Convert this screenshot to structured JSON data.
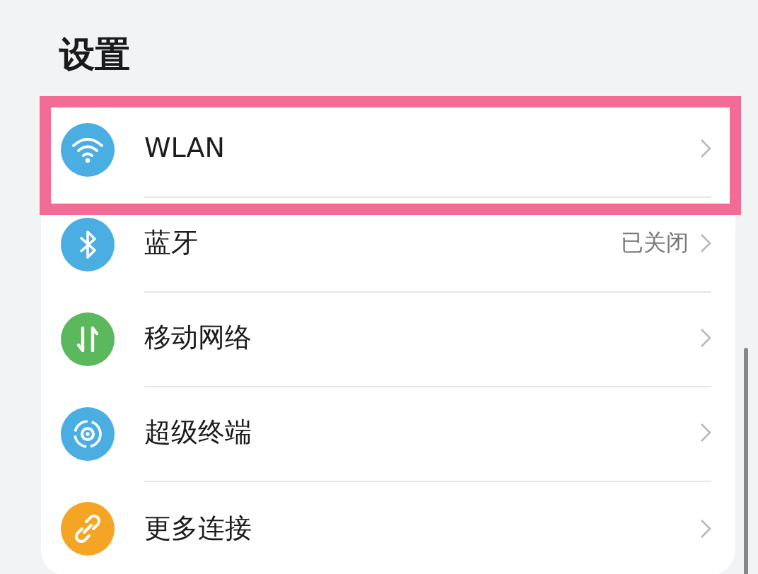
{
  "title": "设置",
  "items": [
    {
      "label": "WLAN",
      "color": "#4aaee3",
      "highlighted": true
    },
    {
      "label": "蓝牙",
      "color": "#4aaee3",
      "highlighted": false,
      "value": "已关闭"
    },
    {
      "label": "移动网络",
      "color": "#5cb85c",
      "highlighted": false
    },
    {
      "label": "超级终端",
      "color": "#4aaee3",
      "highlighted": false
    },
    {
      "label": "更多连接",
      "color": "#f5a524",
      "highlighted": false
    }
  ]
}
